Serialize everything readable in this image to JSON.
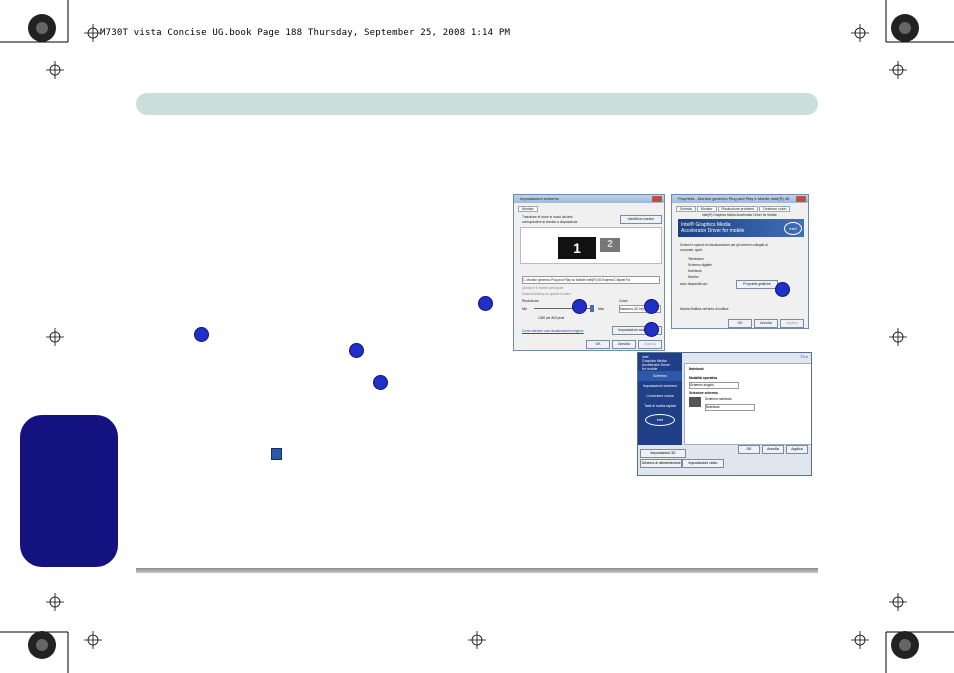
{
  "header": {
    "print_line": "M730T vista Concise UG.book  Page 188  Thursday, September 25, 2008  1:14 PM"
  },
  "callouts": {
    "icon": "numbered-circle"
  },
  "screen_settings": {
    "title": "Impostazioni schermo",
    "tab": "Monitor",
    "instructions_line1": "Trascinare le icone in modo da farle",
    "instructions_line2": "corrispondere ai monitor a disposizione.",
    "identify_button": "Identifica monitor",
    "monitor1": "1",
    "monitor2": "2",
    "monitor_select": "1. Monitor generico Plug and Play su Mobile Intel(R) 45 Express Chipset Fa",
    "check_primary": "Questo è il monitor principale",
    "check_extend": "Estendi desktop su questo monitor",
    "resolution_label": "Risoluzione:",
    "min": "Min",
    "max": "Max",
    "resolution_value": "1280 per 800 pixel",
    "colors_label": "Colori:",
    "colors_value": "Massima (32 bit)",
    "advanced_button": "Impostazioni avanzate...",
    "help_link": "Come ottenere una visualizzazione migliore",
    "ok": "OK",
    "cancel": "Annulla",
    "apply": "Applica"
  },
  "properties": {
    "title": "Proprietà - Monitor generico Plug and Play e Mobile Intel(R) 45",
    "tabs": [
      "Scheda",
      "Monitor",
      "Risoluzione problemi",
      "Gestione colori"
    ],
    "driver_tab": "Intel(R) Graphics Media Accelerator Driver for Mobile",
    "banner_line1": "Intel® Graphics Media",
    "banner_line2": "Accelerator Driver for mobile",
    "logo": "intel",
    "intro_line1": "Schemi e opzioni di visualizzazione per gli schermi collegati al",
    "intro_line2": "computer, quali:",
    "list": [
      "Televisione",
      "Schermo digitale",
      "Notebook",
      "Monitor"
    ],
    "more_label": "sono disponibili qui:",
    "properties_button": "Proprietà grafiche",
    "tray_check": "Mostra Notifica nell'area di notifica",
    "ok": "OK",
    "cancel": "Annulla",
    "apply": "Applica"
  },
  "intel_panel": {
    "brand_line1": "intel",
    "brand_line2": "Graphics Media",
    "brand_line3": "Accelerator Driver",
    "brand_line4": "for mobile",
    "top_icons": "? i ×",
    "device_tab": "Notebook",
    "side_items": [
      "Schermo",
      "Impostazioni schermo",
      "Correzione colore",
      "Tasti di scelta rapida"
    ],
    "logo": "intel",
    "mode_label": "Modalità operativa",
    "mode_value": "Schermo singolo",
    "select_label": "Selezione schermo",
    "display_check": "Schermo notebook",
    "display_value": "Notebook",
    "ok": "OK",
    "cancel": "Annulla",
    "apply": "Applica",
    "bottom_tabs": [
      "Impostazioni 3D",
      "Schema di alimentazione",
      "Impostazioni video"
    ]
  },
  "colors": {
    "band": "#c9e0da",
    "side_tab": "#141180",
    "callout": "#1f2fc8",
    "intel_blue": "#1f3f86"
  }
}
